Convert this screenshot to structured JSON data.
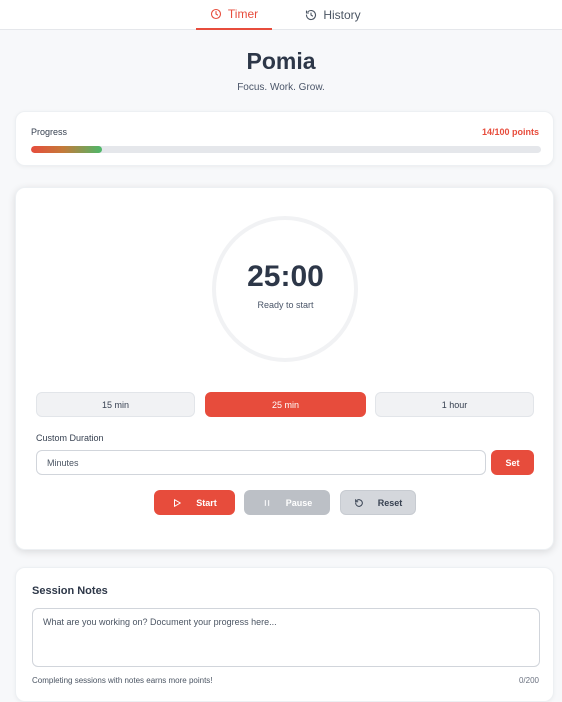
{
  "tabs": {
    "timer_label": "Timer",
    "history_label": "History"
  },
  "header": {
    "title": "Pomia",
    "tagline": "Focus. Work. Grow."
  },
  "progress": {
    "label": "Progress",
    "points_text": "14/100 points",
    "fraction": 0.14
  },
  "timer": {
    "time": "25:00",
    "status": "Ready to start",
    "presets": [
      "15 min",
      "25 min",
      "1 hour"
    ],
    "selected_preset": "25 min",
    "custom_label": "Custom Duration",
    "custom_placeholder": "Minutes",
    "set_label": "Set",
    "start_label": "Start",
    "pause_label": "Pause",
    "reset_label": "Reset"
  },
  "notes": {
    "title": "Session Notes",
    "placeholder": "What are you working on? Document your progress here...",
    "hint": "Completing sessions with notes earns more points!",
    "count": "0/200"
  },
  "colors": {
    "accent": "#e74c3c",
    "progress_end": "#4cb86a"
  }
}
